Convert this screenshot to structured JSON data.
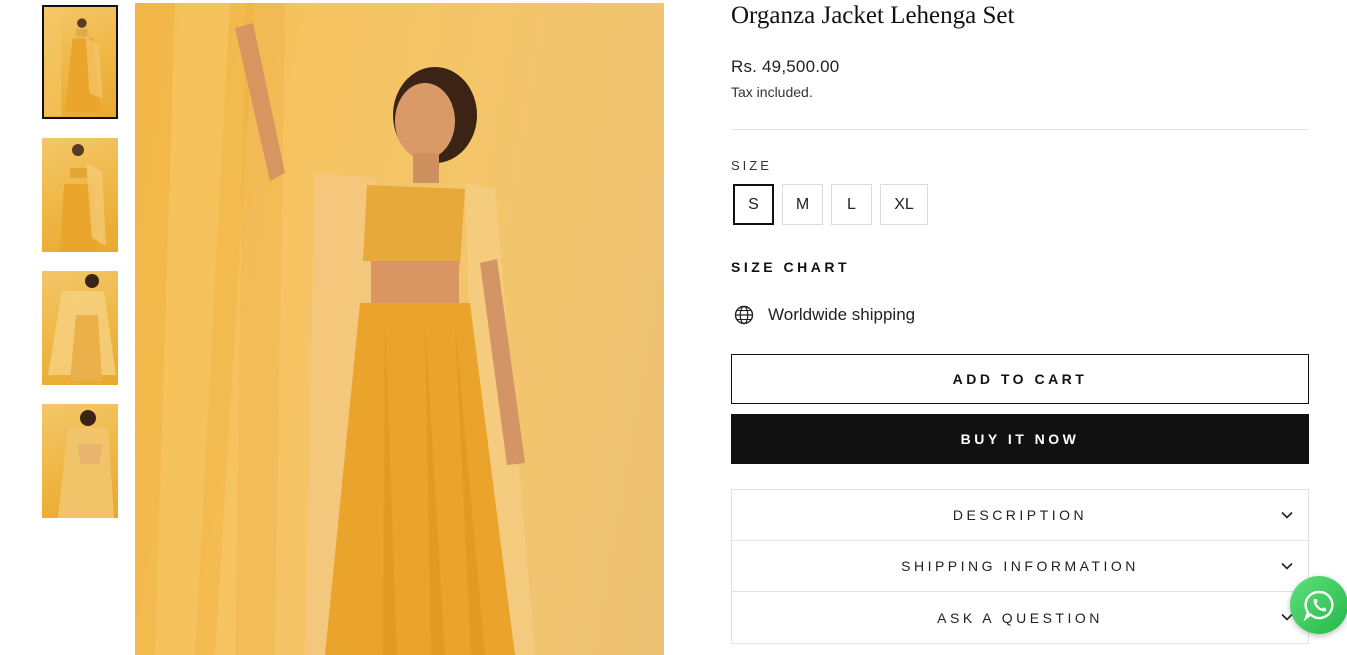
{
  "gallery": {
    "thumbnails": [
      {
        "alt": "thumbnail-1",
        "active": true
      },
      {
        "alt": "thumbnail-2",
        "active": false
      },
      {
        "alt": "thumbnail-3",
        "active": false
      },
      {
        "alt": "thumbnail-4",
        "active": false
      }
    ]
  },
  "product": {
    "title": "Organza Jacket Lehenga Set",
    "price": "Rs. 49,500.00",
    "tax_note": "Tax included.",
    "size_label": "SIZE",
    "sizes": [
      "S",
      "M",
      "L",
      "XL"
    ],
    "selected_size": "S",
    "size_chart_label": "SIZE CHART",
    "shipping_text": "Worldwide shipping",
    "add_to_cart_label": "ADD TO CART",
    "buy_now_label": "BUY IT NOW",
    "accordion": [
      {
        "label": "DESCRIPTION"
      },
      {
        "label": "SHIPPING INFORMATION"
      },
      {
        "label": "ASK A QUESTION"
      }
    ]
  },
  "colors": {
    "accent": "#111111",
    "image_tone": "#f0b94a",
    "whatsapp": "#25b84a"
  },
  "icons": {
    "shipping": "globe-icon",
    "accordion": "chevron-down-icon",
    "chat": "whatsapp-icon"
  }
}
